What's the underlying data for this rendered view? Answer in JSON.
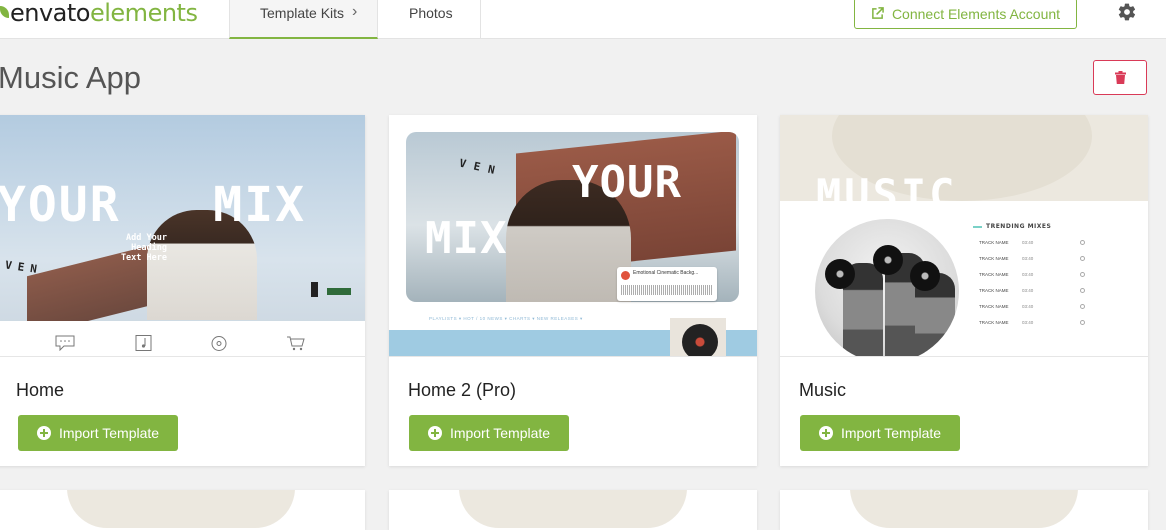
{
  "header": {
    "logo_part1": "envato",
    "logo_part2": "elements",
    "tabs": [
      {
        "label": "Template Kits",
        "active": true
      },
      {
        "label": "Photos",
        "active": false
      }
    ],
    "breadcrumb_chevron": "›",
    "connect_button": "Connect Elements Account",
    "connect_icon": "external-link-icon",
    "settings_icon": "gear-icon"
  },
  "page": {
    "title": "Music App",
    "delete_icon": "trash-icon"
  },
  "colors": {
    "accent": "#82b541",
    "danger": "#d93a57"
  },
  "cards": [
    {
      "name": "Home",
      "button": "Import Template",
      "thumb": {
        "big_text": "YOUR   MIX",
        "small_text": "Add Your Heading Text Here",
        "ven": "VEN"
      }
    },
    {
      "name": "Home 2 (Pro)",
      "button": "Import Template",
      "thumb": {
        "your": "YOUR",
        "mix": "MIX",
        "ven": "VEN",
        "player_title": "Emotional Cinematic Backg...",
        "nav": "PLAYLISTS ▾     HOT / 10 NEWS ▾     CHARTS ▾     NEW RELEASES ▾"
      }
    },
    {
      "name": "Music",
      "button": "Import Template",
      "thumb": {
        "music": "MUSIC",
        "trending": "TRENDING MIXES",
        "tracks": [
          {
            "name": "TRACK NAME",
            "time": "03:40"
          },
          {
            "name": "TRACK NAME",
            "time": "03:40"
          },
          {
            "name": "TRACK NAME",
            "time": "03:40"
          },
          {
            "name": "TRACK NAME",
            "time": "03:40"
          },
          {
            "name": "TRACK NAME",
            "time": "03:40"
          },
          {
            "name": "TRACK NAME",
            "time": "03:40"
          }
        ]
      }
    }
  ]
}
